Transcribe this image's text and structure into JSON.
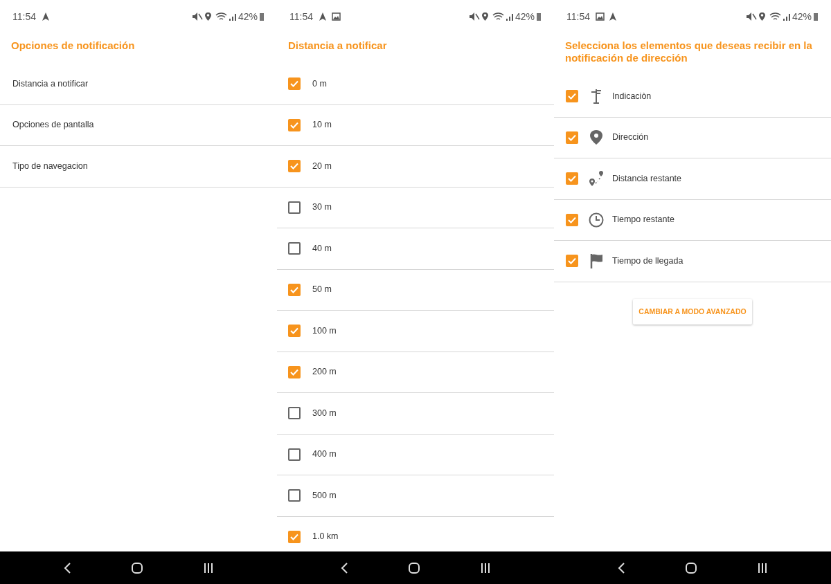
{
  "screens": [
    {
      "status_bar": {
        "time": "11:54",
        "battery": "42%"
      },
      "title": "Opciones de notificación",
      "kind": "menu",
      "items": [
        {
          "label": "Distancia a notificar"
        },
        {
          "label": "Opciones de pantalla"
        },
        {
          "label": "Tipo de navegacion"
        }
      ]
    },
    {
      "status_bar": {
        "time": "11:54",
        "battery": "42%"
      },
      "title": "Distancia a notificar",
      "kind": "checklist",
      "items": [
        {
          "label": "0 m",
          "checked": true
        },
        {
          "label": "10 m",
          "checked": true
        },
        {
          "label": "20 m",
          "checked": true
        },
        {
          "label": "30 m",
          "checked": false
        },
        {
          "label": "40 m",
          "checked": false
        },
        {
          "label": "50 m",
          "checked": true
        },
        {
          "label": "100 m",
          "checked": true
        },
        {
          "label": "200 m",
          "checked": true
        },
        {
          "label": "300 m",
          "checked": false
        },
        {
          "label": "400 m",
          "checked": false
        },
        {
          "label": "500 m",
          "checked": false
        },
        {
          "label": "1.0 km",
          "checked": true
        }
      ]
    },
    {
      "status_bar": {
        "time": "11:54",
        "battery": "42%"
      },
      "title": "Selecciona los elementos que deseas recibir en la notificación de dirección",
      "kind": "icon_checklist",
      "items": [
        {
          "label": "Indicaciòn",
          "checked": true
        },
        {
          "label": "Dirección",
          "checked": true
        },
        {
          "label": "Distancia restante",
          "checked": true
        },
        {
          "label": "Tiempo restante",
          "checked": true
        },
        {
          "label": "Tiempo de llegada",
          "checked": true
        }
      ],
      "button": "CAMBIAR A MODO AVANZADO"
    }
  ]
}
